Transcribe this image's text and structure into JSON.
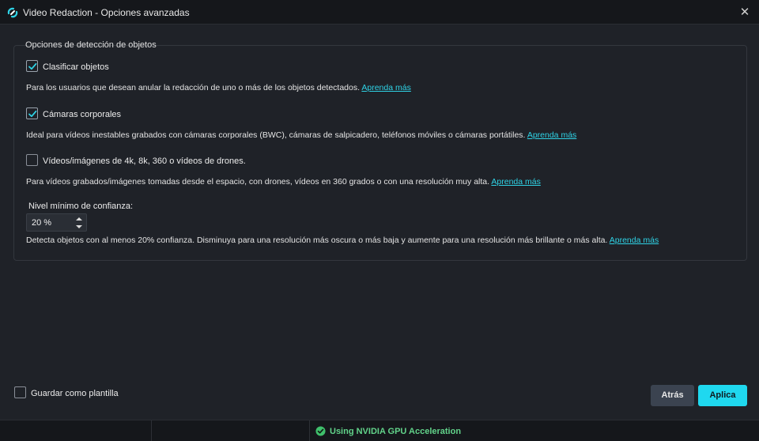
{
  "window": {
    "title": "Video Redaction - Opciones avanzadas",
    "close_icon": "close-icon",
    "app_icon": "app-logo-icon"
  },
  "detection": {
    "legend": "Opciones de detección de objetos",
    "classify": {
      "checked": true,
      "label": "Clasificar objetos",
      "description": "Para los usuarios que desean anular la redacción de uno o más de los objetos detectados.",
      "link": "Aprenda más"
    },
    "body_cams": {
      "checked": true,
      "label": "Cámaras corporales",
      "description": "Ideal para vídeos inestables grabados con cámaras corporales (BWC), cámaras de salpicadero, teléfonos móviles o cámaras portátiles.",
      "link": "Aprenda más"
    },
    "hires": {
      "checked": false,
      "label": "Vídeos/imágenes de 4k, 8k, 360 o vídeos de drones.",
      "description": "Para vídeos grabados/imágenes tomadas desde el espacio, con drones, vídeos en 360 grados o con una resolución muy alta.",
      "link": "Aprenda más"
    },
    "confidence": {
      "label": "Nivel mínimo de confianza:",
      "value": "20 %",
      "description": "Detecta objetos con al menos 20% confianza. Disminuya para una resolución más oscura o más baja y aumente para una resolución más brillante o más alta.",
      "link": "Aprenda más"
    }
  },
  "footer": {
    "save_template": {
      "checked": false,
      "label": "Guardar como plantilla"
    },
    "back_label": "Atrás",
    "apply_label": "Aplica"
  },
  "status": {
    "gpu_text": "Using NVIDIA GPU Acceleration",
    "gpu_icon": "check-circle-icon"
  },
  "colors": {
    "accent": "#1fd8ef",
    "link": "#2fd3e6",
    "status_ok": "#62d38a",
    "background": "#1f2228"
  }
}
